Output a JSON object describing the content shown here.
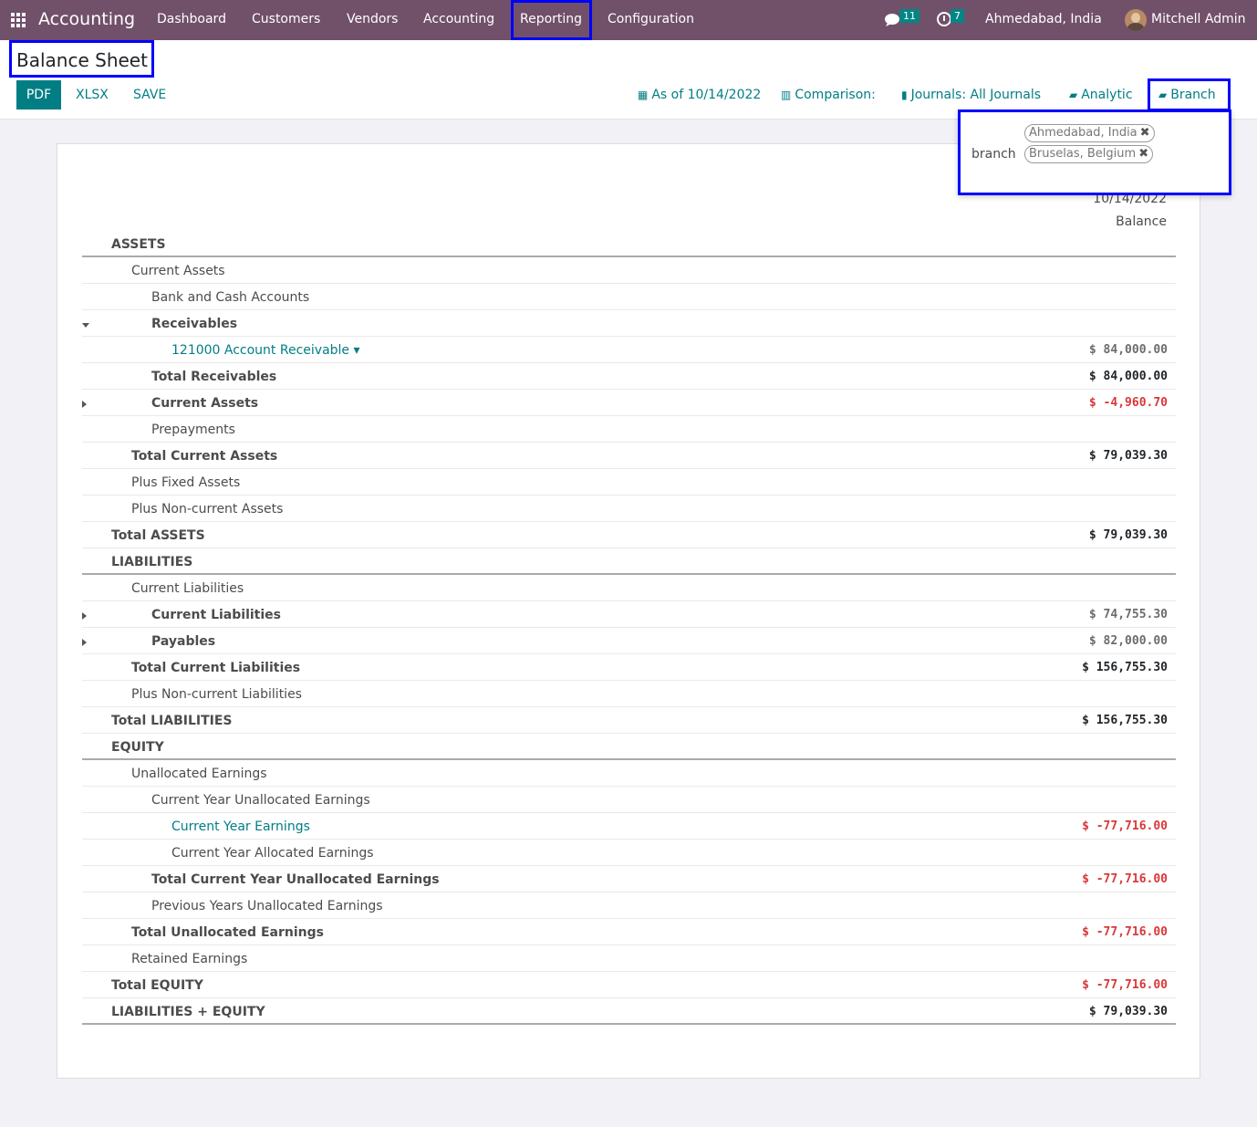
{
  "navbar": {
    "brand": "Accounting",
    "menu": [
      "Dashboard",
      "Customers",
      "Vendors",
      "Accounting",
      "Reporting",
      "Configuration"
    ],
    "chat_count": "11",
    "activity_count": "7",
    "company": "Ahmedabad, India",
    "user": "Mitchell Admin"
  },
  "control": {
    "title": "Balance Sheet",
    "pdf": "PDF",
    "xlsx": "XLSX",
    "save": "SAVE",
    "date_filter": "As of 10/14/2022",
    "comparison": "Comparison:",
    "journals": "Journals: All Journals",
    "analytic": "Analytic",
    "branch": "Branch"
  },
  "branch_dropdown": {
    "label": "branch",
    "tags": [
      "Ahmedabad, India",
      "Bruselas, Belgium"
    ]
  },
  "report": {
    "col_date": "10/14/2022",
    "col_balance": "Balance",
    "rows": [
      {
        "label": "ASSETS",
        "amount": ""
      },
      {
        "label": "Current Assets",
        "amount": ""
      },
      {
        "label": "Bank and Cash Accounts",
        "amount": ""
      },
      {
        "label": "Receivables",
        "amount": ""
      },
      {
        "label": "121000 Account Receivable",
        "amount": "$ 84,000.00"
      },
      {
        "label": "Total Receivables",
        "amount": "$ 84,000.00"
      },
      {
        "label": "Current Assets",
        "amount": "$ -4,960.70"
      },
      {
        "label": "Prepayments",
        "amount": ""
      },
      {
        "label": "Total Current Assets",
        "amount": "$ 79,039.30"
      },
      {
        "label": "Plus Fixed Assets",
        "amount": ""
      },
      {
        "label": "Plus Non-current Assets",
        "amount": ""
      },
      {
        "label": "Total ASSETS",
        "amount": "$ 79,039.30"
      },
      {
        "label": "LIABILITIES",
        "amount": ""
      },
      {
        "label": "Current Liabilities",
        "amount": ""
      },
      {
        "label": "Current Liabilities",
        "amount": "$ 74,755.30"
      },
      {
        "label": "Payables",
        "amount": "$ 82,000.00"
      },
      {
        "label": "Total Current Liabilities",
        "amount": "$ 156,755.30"
      },
      {
        "label": "Plus Non-current Liabilities",
        "amount": ""
      },
      {
        "label": "Total LIABILITIES",
        "amount": "$ 156,755.30"
      },
      {
        "label": "EQUITY",
        "amount": ""
      },
      {
        "label": "Unallocated Earnings",
        "amount": ""
      },
      {
        "label": "Current Year Unallocated Earnings",
        "amount": ""
      },
      {
        "label": "Current Year Earnings",
        "amount": "$ -77,716.00"
      },
      {
        "label": "Current Year Allocated Earnings",
        "amount": ""
      },
      {
        "label": "Total Current Year Unallocated Earnings",
        "amount": "$ -77,716.00"
      },
      {
        "label": "Previous Years Unallocated Earnings",
        "amount": ""
      },
      {
        "label": "Total Unallocated Earnings",
        "amount": "$ -77,716.00"
      },
      {
        "label": "Retained Earnings",
        "amount": ""
      },
      {
        "label": "Total EQUITY",
        "amount": "$ -77,716.00"
      },
      {
        "label": "LIABILITIES + EQUITY",
        "amount": "$ 79,039.30"
      }
    ]
  },
  "colors": {
    "navbar": "#71506a",
    "accent": "#017e84",
    "negative": "#d9383a",
    "highlight": "#0000ff"
  }
}
